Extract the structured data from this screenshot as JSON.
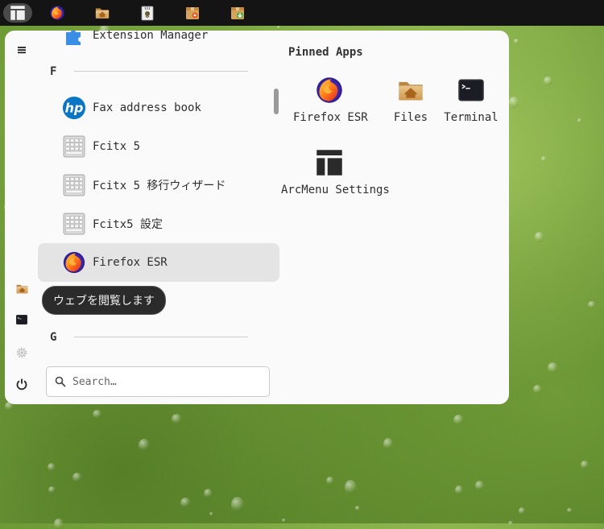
{
  "taskbar": {
    "items": [
      {
        "name": "arcmenu-button",
        "icon": "arcmenu-layout-icon",
        "active": true
      },
      {
        "name": "firefox-launcher",
        "icon": "firefox-icon"
      },
      {
        "name": "files-launcher",
        "icon": "home-folder-icon"
      },
      {
        "name": "gimp-launcher",
        "icon": "gimp-icon"
      },
      {
        "name": "ubuntu-software-launcher",
        "icon": "software-package-icon"
      },
      {
        "name": "package-installer-launcher",
        "icon": "package-download-icon"
      }
    ]
  },
  "menu": {
    "sidebar": {
      "hamburger": "hamburger-icon",
      "icons": [
        "home-folder-icon",
        "terminal-icon",
        "settings-gear-icon",
        "power-icon"
      ]
    },
    "applist": {
      "partial_item": "Extension Manager",
      "section_f": "F",
      "items": [
        {
          "label": "Fax address book",
          "icon": "hp-icon"
        },
        {
          "label": "Fcitx 5",
          "icon": "keyboard-icon"
        },
        {
          "label": "Fcitx 5 移行ウィザード",
          "icon": "keyboard-icon"
        },
        {
          "label": "Fcitx5 設定",
          "icon": "keyboard-icon"
        },
        {
          "label": "Firefox ESR",
          "icon": "firefox-icon",
          "hovered": true
        }
      ],
      "section_g": "G"
    },
    "tooltip": "ウェブを閲覧します",
    "search": {
      "placeholder": "Search…"
    },
    "pinned": {
      "title": "Pinned Apps",
      "apps": [
        {
          "label": "Firefox ESR",
          "icon": "firefox-icon"
        },
        {
          "label": "Files",
          "icon": "home-folder-icon"
        },
        {
          "label": "Terminal",
          "icon": "terminal-icon"
        },
        {
          "label": "ArcMenu Settings",
          "icon": "arcmenu-layout-icon"
        }
      ]
    }
  }
}
